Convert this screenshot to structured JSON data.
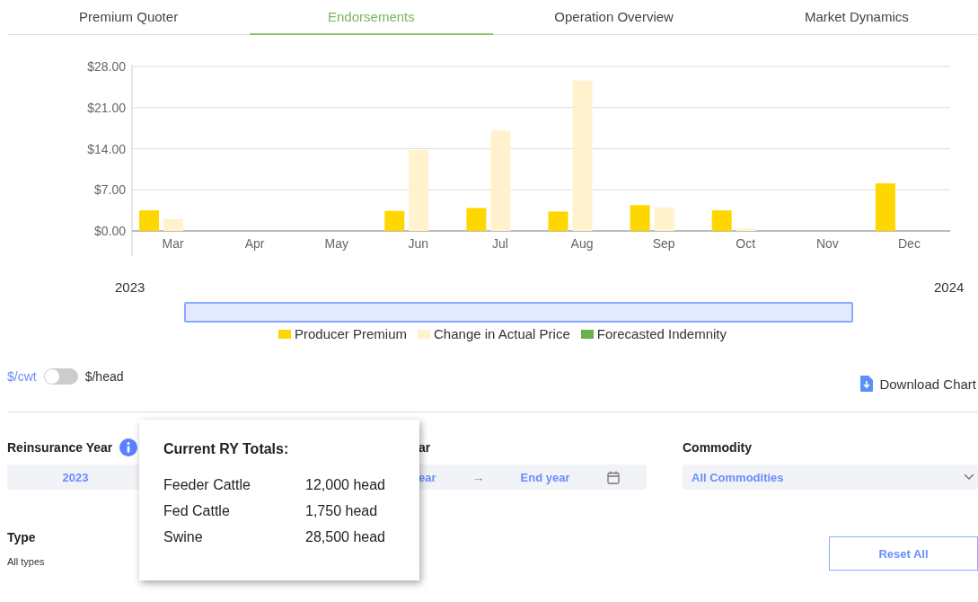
{
  "tabs": [
    {
      "label": "Premium Quoter",
      "selected": false
    },
    {
      "label": "Endorsements",
      "selected": true
    },
    {
      "label": "Operation Overview",
      "selected": false
    },
    {
      "label": "Market Dynamics",
      "selected": false
    }
  ],
  "chart": {
    "timeline_start": "2023",
    "timeline_end": "2024",
    "chart_data": {
      "type": "bar",
      "categories": [
        "Mar",
        "Apr",
        "May",
        "Jun",
        "Jul",
        "Aug",
        "Sep",
        "Oct",
        "Nov",
        "Dec"
      ],
      "series": [
        {
          "name": "Producer Premium",
          "color": "#ffd700",
          "values": [
            3.5,
            null,
            null,
            3.4,
            3.9,
            3.3,
            4.4,
            3.5,
            null,
            8.1
          ]
        },
        {
          "name": "Change in Actual Price",
          "color": "#fff2cc",
          "values": [
            2.0,
            null,
            null,
            13.8,
            17.1,
            25.6,
            4.0,
            0.4,
            null,
            null
          ]
        },
        {
          "name": "Forecasted Indemnity",
          "color": "#6ab04c",
          "values": [
            null,
            null,
            null,
            null,
            null,
            null,
            null,
            null,
            null,
            null
          ]
        }
      ],
      "ylim": [
        0,
        28
      ],
      "grid": true,
      "legend": true,
      "yticks": [
        {
          "value": 0,
          "label": "$0.00"
        },
        {
          "value": 7,
          "label": "$7.00"
        },
        {
          "value": 14,
          "label": "$14.00"
        },
        {
          "value": 21,
          "label": "$21.00"
        },
        {
          "value": 28,
          "label": "$28.00"
        }
      ]
    }
  },
  "unit_toggle": {
    "off_label": "$/cwt",
    "on_label": "$/head",
    "on": false
  },
  "download_button": "Download Chart",
  "filters": {
    "reinsurance_year": {
      "label": "Reinsurance Year",
      "value": "2023"
    },
    "year_range": {
      "label": "ar",
      "start_placeholder": "ear",
      "arrow": "→",
      "end_placeholder": "End year"
    },
    "commodity": {
      "label": "Commodity",
      "value": "All Commodities"
    },
    "type": {
      "label": "Type",
      "value": "All types"
    },
    "reset_button": "Reset All"
  },
  "tooltip": {
    "title": "Current RY Totals:",
    "rows": [
      {
        "name": "Feeder Cattle",
        "value": "12,000 head"
      },
      {
        "name": "Fed Cattle",
        "value": "1,750 head"
      },
      {
        "name": "Swine",
        "value": "28,500 head"
      }
    ]
  }
}
